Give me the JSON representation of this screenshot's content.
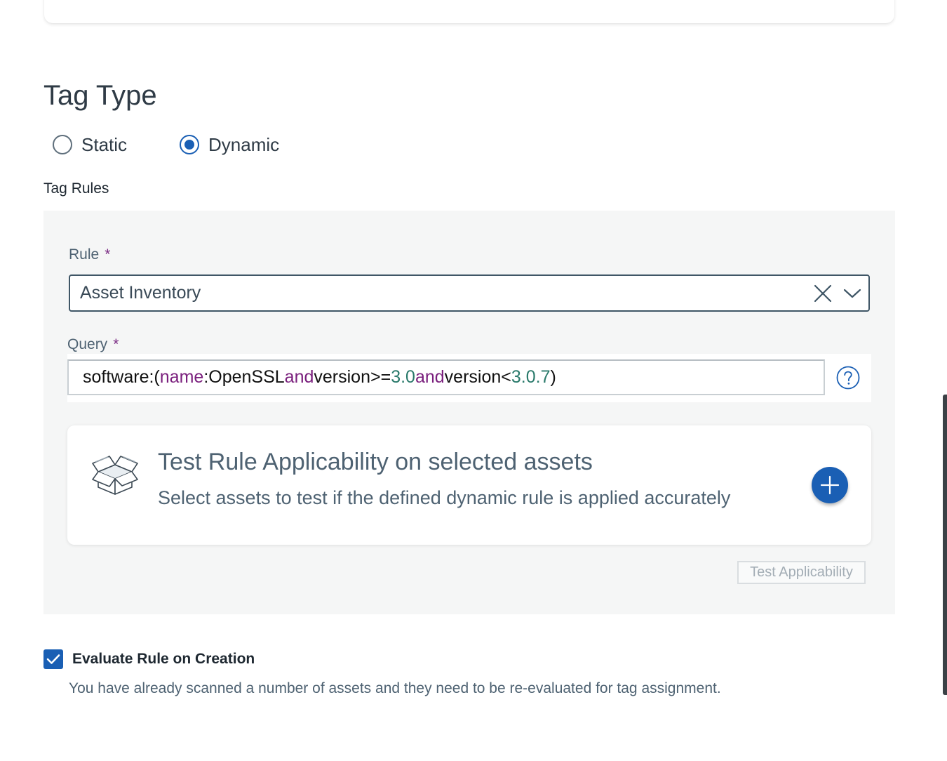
{
  "tag_type": {
    "title": "Tag Type",
    "options": [
      {
        "label": "Static",
        "selected": false
      },
      {
        "label": "Dynamic",
        "selected": true
      }
    ]
  },
  "tag_rules": {
    "heading": "Tag Rules",
    "rule": {
      "label": "Rule",
      "required_mark": "*",
      "value": "Asset Inventory",
      "clear_icon": "close-icon",
      "dropdown_icon": "chevron-down-icon"
    },
    "query": {
      "label": "Query",
      "required_mark": "*",
      "tokens": {
        "t1": "software:(",
        "t2": "name",
        "t3": ":OpenSSL ",
        "t4": "and",
        "t5": " version>=",
        "t6": "3.0",
        "t7": " ",
        "t8": "and",
        "t9": " version< ",
        "t10": "3.0.7",
        "t11": ")"
      },
      "help_icon": "question-circle-icon"
    },
    "test_card": {
      "icon": "open-box-icon",
      "title": "Test Rule Applicability on selected assets",
      "subtitle": "Select assets to test if the defined dynamic rule is applied accurately",
      "add_icon": "plus-icon"
    },
    "test_button": "Test Applicability"
  },
  "evaluate": {
    "checked": true,
    "label": "Evaluate Rule on Creation",
    "description": "You have already scanned a number of assets and they need to be re-evaluated for tag assignment."
  },
  "colors": {
    "accent": "#1a5fb4",
    "keyword": "#7a1f7d",
    "number": "#2a7a6b",
    "required": "#7a2b83"
  }
}
